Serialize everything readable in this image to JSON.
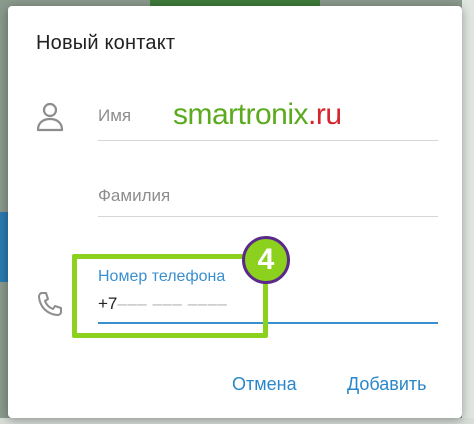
{
  "dialog": {
    "title": "Новый контакт",
    "fields": {
      "first_name_placeholder": "Имя",
      "last_name_placeholder": "Фамилия",
      "phone_label": "Номер телефона",
      "phone_prefix": "+7",
      "phone_mask": "––– ––– ––––"
    },
    "buttons": {
      "cancel": "Отмена",
      "add": "Добавить"
    }
  },
  "watermark": {
    "part1": "smartronix",
    "part2": ".ru"
  },
  "annotation": {
    "step_number": "4"
  },
  "colors": {
    "accent": "#2a87c9",
    "highlight": "#8cd11e",
    "badge_border": "#5a2a8a"
  },
  "icons": {
    "name": "person-icon",
    "phone": "phone-icon"
  }
}
